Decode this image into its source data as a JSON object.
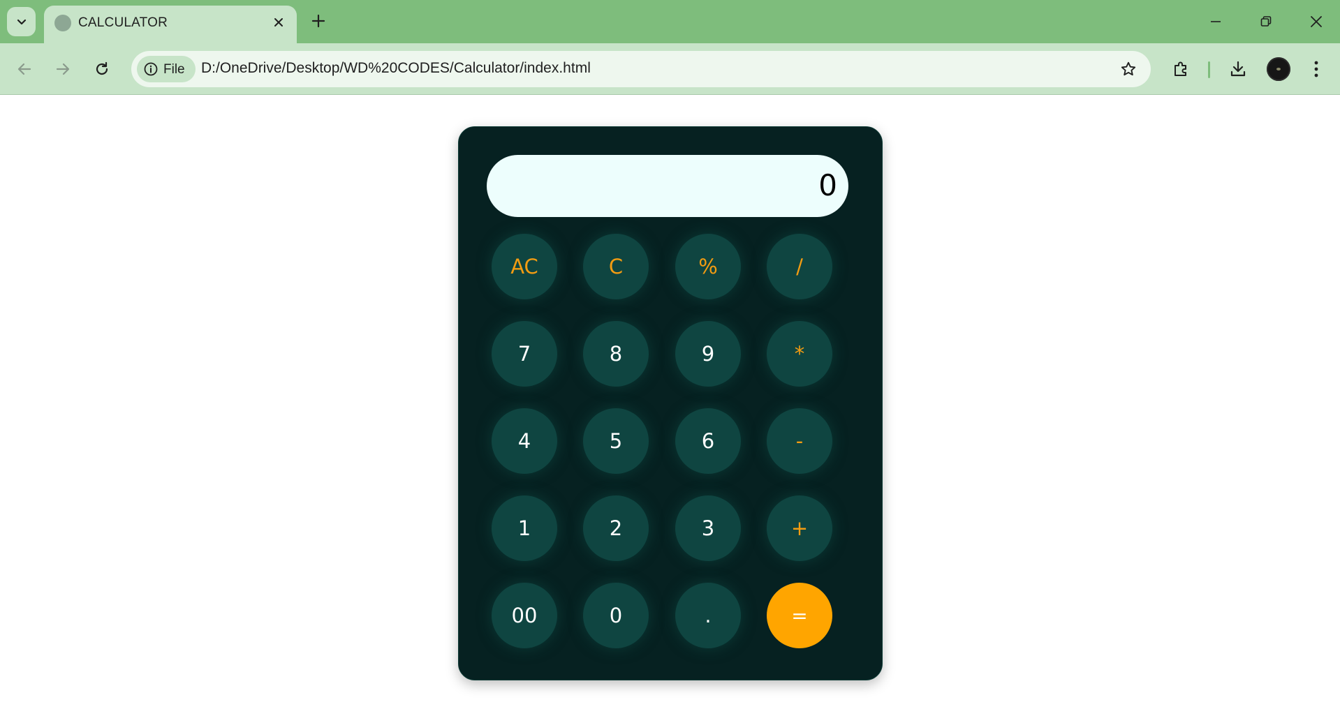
{
  "browser": {
    "tab_title": "CALCULATOR",
    "address_chip_label": "File",
    "url": "D:/OneDrive/Desktop/WD%20CODES/Calculator/index.html",
    "accent_color": "#7ebd7c",
    "toolbar_color": "#c7e4c8"
  },
  "calculator": {
    "display_value": "0",
    "keys": [
      {
        "label": "AC",
        "kind": "operator"
      },
      {
        "label": "C",
        "kind": "operator"
      },
      {
        "label": "%",
        "kind": "operator"
      },
      {
        "label": "/",
        "kind": "operator"
      },
      {
        "label": "7",
        "kind": "digit"
      },
      {
        "label": "8",
        "kind": "digit"
      },
      {
        "label": "9",
        "kind": "digit"
      },
      {
        "label": "*",
        "kind": "operator"
      },
      {
        "label": "4",
        "kind": "digit"
      },
      {
        "label": "5",
        "kind": "digit"
      },
      {
        "label": "6",
        "kind": "digit"
      },
      {
        "label": "-",
        "kind": "operator"
      },
      {
        "label": "1",
        "kind": "digit"
      },
      {
        "label": "2",
        "kind": "digit"
      },
      {
        "label": "3",
        "kind": "digit"
      },
      {
        "label": "+",
        "kind": "operator"
      },
      {
        "label": "00",
        "kind": "digit"
      },
      {
        "label": "0",
        "kind": "digit"
      },
      {
        "label": ".",
        "kind": "digit"
      },
      {
        "label": "=",
        "kind": "equals"
      }
    ],
    "colors": {
      "body": "#062121",
      "key": "#0f4541",
      "operator_text": "#f39c12",
      "equals": "#ffa500",
      "display": "#edfefd"
    }
  }
}
